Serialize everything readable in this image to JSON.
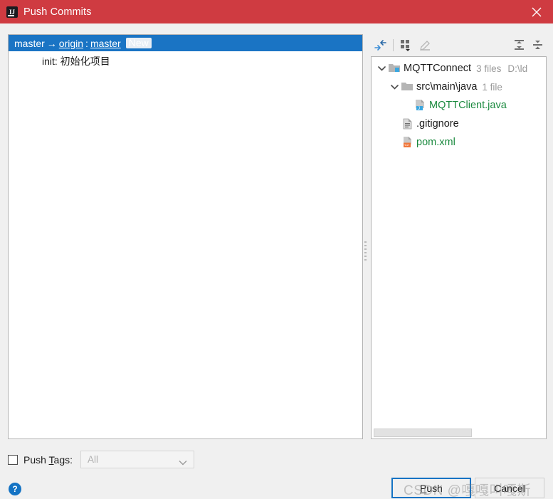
{
  "window": {
    "title": "Push Commits",
    "app_icon": "intellij-idea-icon",
    "titlebar_color": "#cf3b41",
    "close_label": "✕"
  },
  "commit_list": {
    "header": {
      "local_branch": "master",
      "arrow": "→",
      "remote": "origin",
      "separator": ":",
      "remote_branch": "master",
      "badge": "New",
      "selected_color": "#1a74c4"
    },
    "commits": [
      {
        "message": "init:  初始化项目"
      }
    ]
  },
  "tree_toolbar": {
    "buttons": [
      {
        "name": "collapse-changes-icon",
        "label": "Collapse",
        "enabled": true
      },
      {
        "name": "group-by-icon",
        "label": "Group By",
        "enabled": true
      },
      {
        "name": "edit-source-icon",
        "label": "Edit Source",
        "enabled": false
      },
      {
        "name": "expand-all-icon",
        "label": "Expand All",
        "enabled": true
      },
      {
        "name": "collapse-all-icon",
        "label": "Collapse All",
        "enabled": true
      }
    ]
  },
  "file_tree": {
    "nodes": [
      {
        "label": "MQTTConnect",
        "icon": "module-folder-icon",
        "meta": "3 files",
        "path": "D:\\ld",
        "expanded": true,
        "depth": 0,
        "color": "default"
      },
      {
        "label": "src\\main\\java",
        "icon": "folder-icon",
        "meta": "1 file",
        "path": "",
        "expanded": true,
        "depth": 1,
        "color": "default"
      },
      {
        "label": "MQTTClient.java",
        "icon": "java-file-icon",
        "meta": "",
        "path": "",
        "expanded": null,
        "depth": 2,
        "color": "green"
      },
      {
        "label": ".gitignore",
        "icon": "text-file-icon",
        "meta": "",
        "path": "",
        "expanded": null,
        "depth": 1,
        "color": "default"
      },
      {
        "label": "pom.xml",
        "icon": "xml-file-icon",
        "meta": "",
        "path": "",
        "expanded": null,
        "depth": 1,
        "color": "green"
      }
    ]
  },
  "push_tags": {
    "checked": false,
    "label_pre": "Push ",
    "label_mnemonic": "T",
    "label_post": "ags:",
    "dropdown_value": "All",
    "dropdown_enabled": false
  },
  "footer": {
    "help": "?",
    "push_mnemonic": "P",
    "push_rest": "ush",
    "cancel_label": "Cancel"
  },
  "watermark": {
    "text": "CSDN @嘎嘎叫嘎斯"
  }
}
